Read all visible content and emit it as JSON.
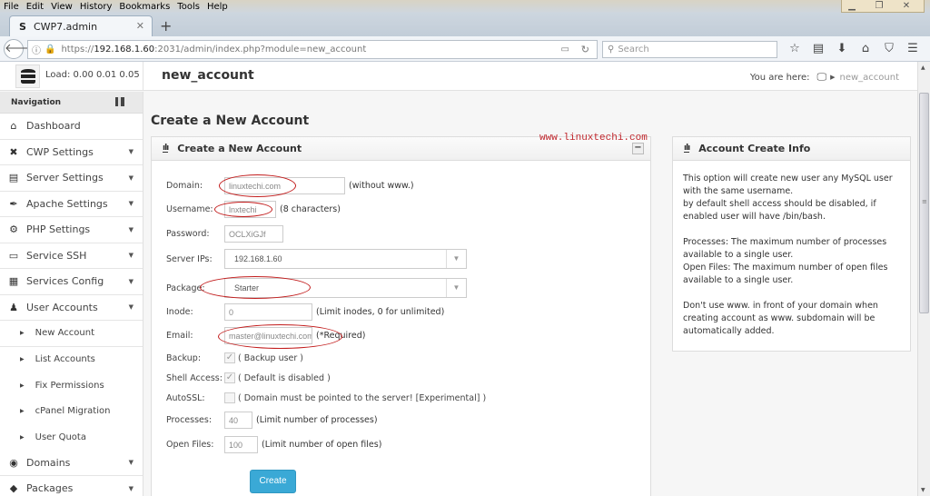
{
  "browser": {
    "menu": [
      "File",
      "Edit",
      "View",
      "History",
      "Bookmarks",
      "Tools",
      "Help"
    ],
    "tab_title": "CWP7.admin",
    "tab_favicon": "S",
    "url_prefix": "https://",
    "url_host": "192.168.1.60",
    "url_rest": ":2031/admin/index.php?module=new_account",
    "search_placeholder": "Search",
    "window_controls": [
      "minimize-icon",
      "restore-icon",
      "close-icon"
    ],
    "toolbar_icons": [
      "star-icon",
      "reading-list-icon",
      "download-icon",
      "home-icon",
      "pocket-icon",
      "menu-icon"
    ]
  },
  "header": {
    "load_label": "Load: 0.00  0.01  0.05",
    "page_title": "new_account",
    "breadcrumb_label": "You are here:",
    "breadcrumb_current": "new_account"
  },
  "sidebar": {
    "heading": "Navigation",
    "items": [
      {
        "label": "Dashboard",
        "icon": "home-icon",
        "glyph": "⌂",
        "caret": false
      },
      {
        "label": "CWP Settings",
        "icon": "tools-icon",
        "glyph": "✖",
        "caret": true
      },
      {
        "label": "Server Settings",
        "icon": "server-icon",
        "glyph": "▤",
        "caret": true
      },
      {
        "label": "Apache Settings",
        "icon": "feather-icon",
        "glyph": "✒",
        "caret": true
      },
      {
        "label": "PHP Settings",
        "icon": "gear-icon",
        "glyph": "⚙",
        "caret": true
      },
      {
        "label": "Service SSH",
        "icon": "monitor-icon",
        "glyph": "▭",
        "caret": true
      },
      {
        "label": "Services Config",
        "icon": "inbox-icon",
        "glyph": "▦",
        "caret": true
      },
      {
        "label": "User Accounts",
        "icon": "user-icon",
        "glyph": "♟",
        "caret": true
      }
    ],
    "subitems": [
      "New Account",
      "List Accounts",
      "Fix Permissions",
      "cPanel Migration",
      "User Quota"
    ],
    "items_after": [
      {
        "label": "Domains",
        "icon": "globe-icon",
        "glyph": "◉",
        "caret": true
      },
      {
        "label": "Packages",
        "icon": "box-icon",
        "glyph": "◆",
        "caret": true
      }
    ]
  },
  "main": {
    "heading": "Create a New Account",
    "panel_title": "Create a New Account",
    "collapse_label": "−",
    "fields": {
      "domain": {
        "label": "Domain:",
        "value": "linuxtechi.com",
        "hint": "(without www.)"
      },
      "username": {
        "label": "Username:",
        "value": "lnxtechi",
        "hint": "(8 characters)"
      },
      "password": {
        "label": "Password:",
        "value": "OCLXiGJf"
      },
      "server_ips": {
        "label": "Server IPs:",
        "value": "192.168.1.60"
      },
      "package": {
        "label": "Package:",
        "value": "Starter"
      },
      "inode": {
        "label": "Inode:",
        "value": "0",
        "hint": "(Limit inodes, 0 for unlimited)"
      },
      "email": {
        "label": "Email:",
        "value": "master@linuxtechi.com",
        "hint": "(*Required)"
      },
      "backup": {
        "label": "Backup:",
        "checked": true,
        "hint": "( Backup user )"
      },
      "shell_access": {
        "label": "Shell Access:",
        "checked": true,
        "hint": "( Default is disabled )"
      },
      "autossl": {
        "label": "AutoSSL:",
        "checked": false,
        "hint": "( Domain must be pointed to the server! [Experimental] )"
      },
      "processes": {
        "label": "Processes:",
        "value": "40",
        "hint": "(Limit number of processes)"
      },
      "open_files": {
        "label": "Open Files:",
        "value": "100",
        "hint": "(Limit number of open files)"
      }
    },
    "create_button": "Create"
  },
  "info_panel": {
    "title": "Account Create Info",
    "paragraphs": [
      "This option will create new user any MySQL user with the same username.\nby default shell access should be disabled, if enabled user will have /bin/bash.",
      "Processes: The maximum number of processes available to a single user.\nOpen Files: The maximum number of open files available to a single user.",
      "Don't use www. in front of your domain when creating account as www. subdomain will be automatically added."
    ]
  },
  "watermark": "www.linuxtechi.com",
  "colors": {
    "accent_button": "#3aa9d6",
    "annotation_red": "#c21c1c",
    "watermark": "#c0282e"
  }
}
